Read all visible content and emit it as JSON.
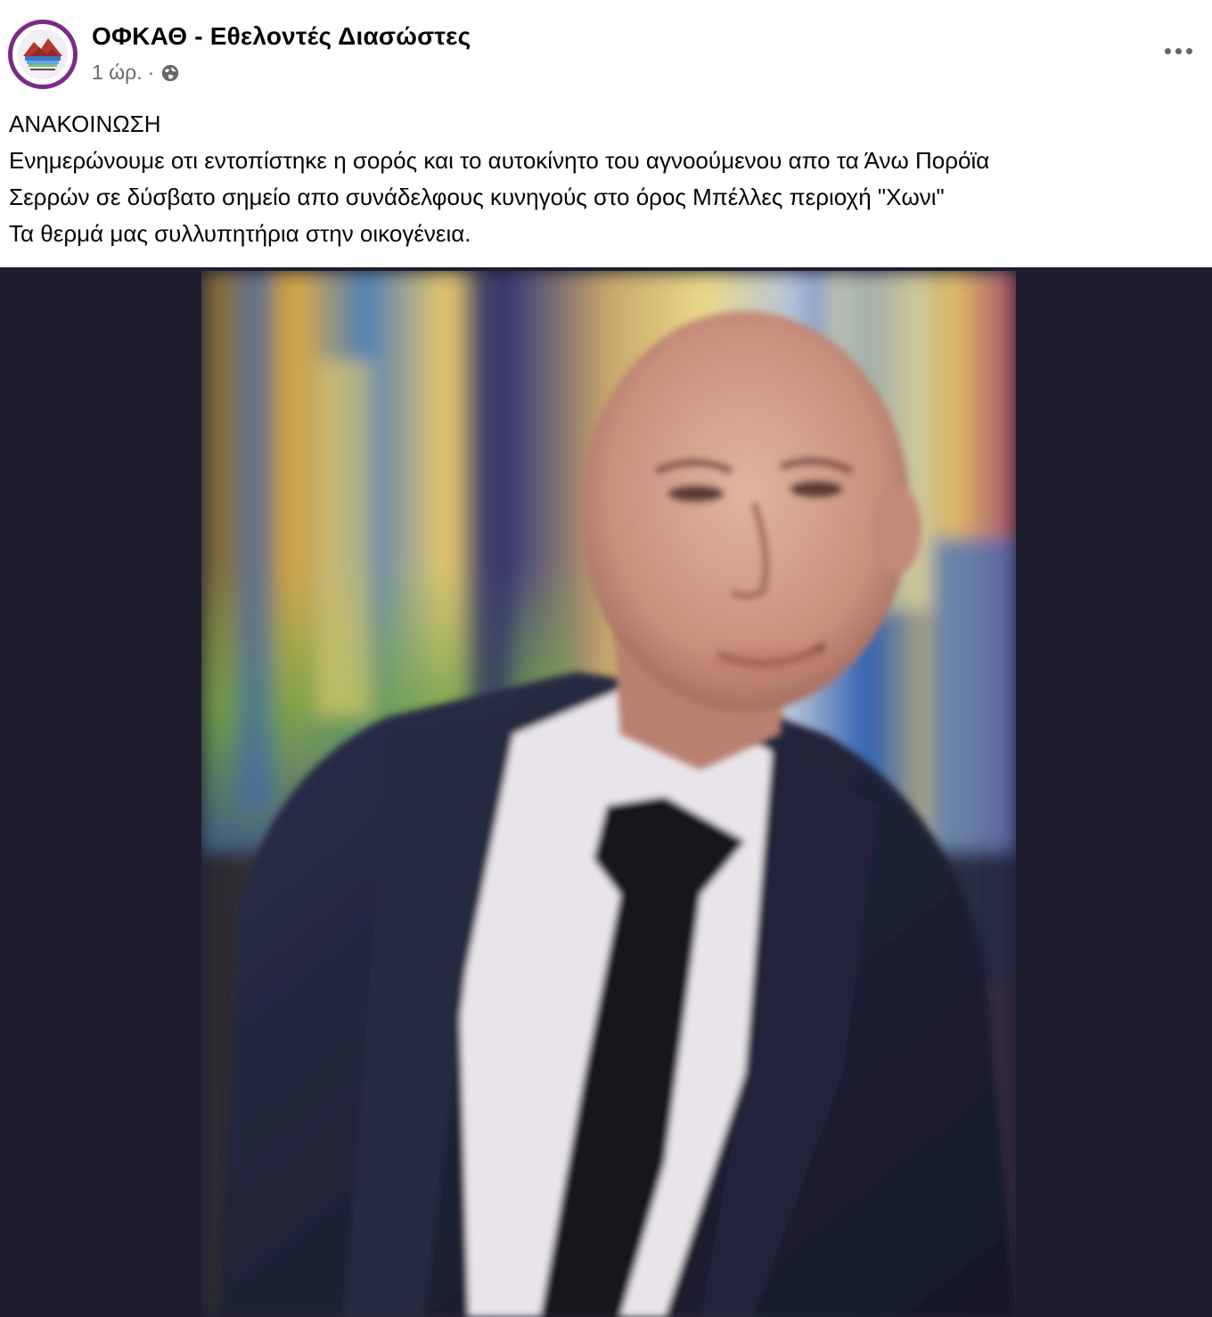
{
  "post": {
    "author": "ΟΦΚΑΘ - Εθελοντές Διασώστες",
    "time": "1 ώρ.",
    "separator": "·",
    "privacy_icon": "globe-icon",
    "more_icon": "more-horizontal-icon",
    "avatar_icon": "organization-logo",
    "text_lines": [
      "ΑΝΑΚΟΙΝΩΣΗ",
      "Ενημερώνουμε οτι εντοπίστηκε η σορός και το αυτοκίνητο του αγνοούμενου απο τα Άνω Πορόϊα",
      "Σερρών σε δύσβατο σημείο απο συνάδελφους κυνηγούς στο όρος Μπέλλες περιοχή \"Χωνι\"",
      "Τα θερμά μας συλλυπητήρια στην οικογένεια."
    ],
    "photo_background_color": "#1e1e2e"
  }
}
